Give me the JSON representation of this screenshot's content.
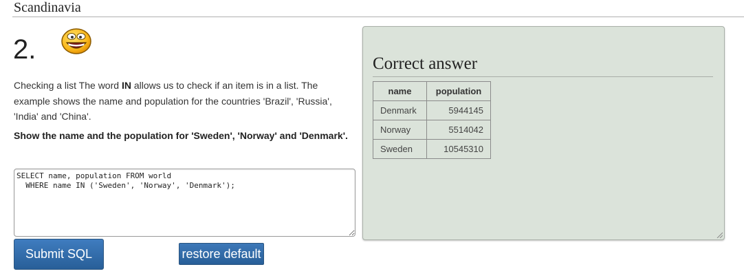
{
  "page": {
    "section_title": "Scandinavia"
  },
  "question": {
    "number": "2.",
    "smiley_icon": "grinning-smiley-icon",
    "description": {
      "before": "Checking a list The word ",
      "keyword": "IN",
      "after": " allows us to check if an item is in a list. The example shows the name and population for the countries 'Brazil', 'Russia', 'India' and 'China'."
    },
    "task": "Show the name and the population for 'Sweden', 'Norway' and 'Denmark'."
  },
  "editor": {
    "sql": "SELECT name, population FROM world\n  WHERE name IN ('Sweden', 'Norway', 'Denmark');"
  },
  "buttons": {
    "submit_label": "Submit SQL",
    "restore_label": "restore default",
    "color": "#2f6aa8"
  },
  "answer": {
    "title": "Correct answer",
    "background_color": "#dbe3da",
    "columns": [
      "name",
      "population"
    ],
    "rows": [
      [
        "Denmark",
        "5944145"
      ],
      [
        "Norway",
        "5514042"
      ],
      [
        "Sweden",
        "10545310"
      ]
    ]
  }
}
